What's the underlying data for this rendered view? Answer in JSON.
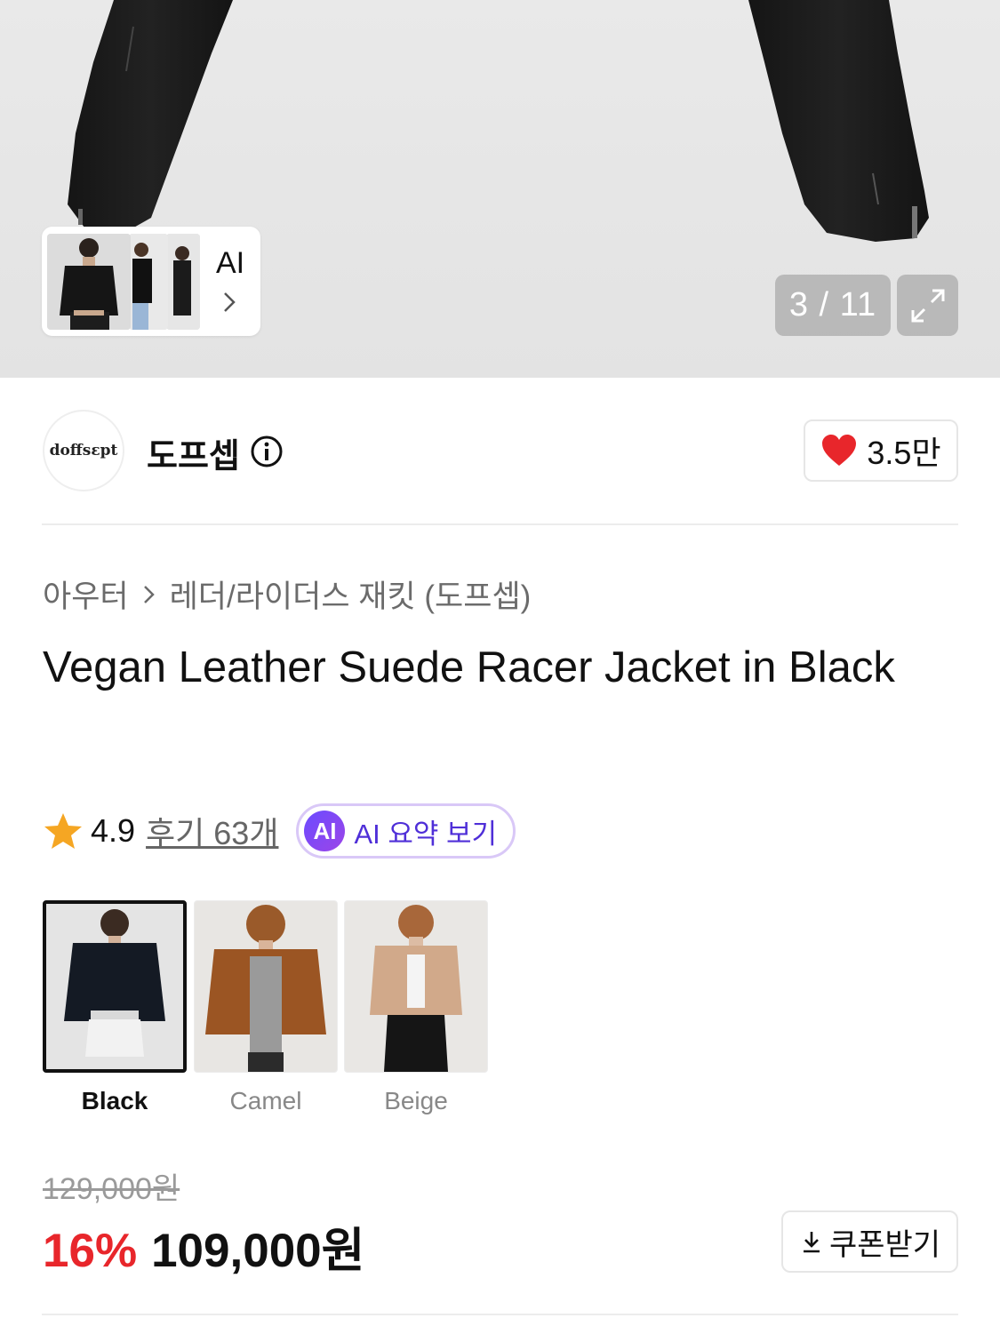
{
  "gallery": {
    "counter": "3 / 11",
    "ai_thumb_label": "AI"
  },
  "brand": {
    "logo_text": "doffsεpt",
    "name": "도프셉",
    "likes": "3.5만"
  },
  "breadcrumb": {
    "category": "아우터",
    "subcategory": "레더/라이더스 재킷 (도프셉)"
  },
  "product": {
    "title": "Vegan Leather Suede Racer Jacket in Black"
  },
  "rating": {
    "score": "4.9",
    "reviews_label": "후기 63개",
    "ai_badge": "AI",
    "ai_summary_label": "AI 요약 보기"
  },
  "colors": [
    {
      "label": "Black",
      "selected": true
    },
    {
      "label": "Camel",
      "selected": false
    },
    {
      "label": "Beige",
      "selected": false
    }
  ],
  "price": {
    "original": "129,000원",
    "discount": "16%",
    "sale": "109,000원"
  },
  "coupon": {
    "label": "쿠폰받기"
  },
  "theme": {
    "discount_color": "#e8262b",
    "heart_color": "#e8262b",
    "star_color": "#f5a623",
    "ai_accent": "#4f2fd8"
  }
}
